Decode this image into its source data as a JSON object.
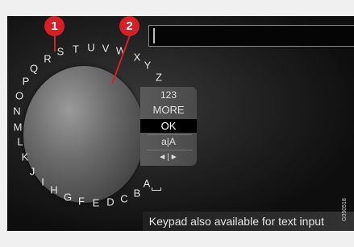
{
  "wheel": {
    "letters": [
      "A",
      "B",
      "C",
      "D",
      "E",
      "F",
      "G",
      "H",
      "I",
      "J",
      "K",
      "L",
      "M",
      "N",
      "O",
      "P",
      "Q",
      "R",
      "S",
      "T",
      "U",
      "V",
      "W",
      "X",
      "Y",
      "Z"
    ]
  },
  "menu": {
    "items": [
      {
        "label": "123"
      },
      {
        "label": "MORE"
      },
      {
        "label": "OK"
      },
      {
        "label": "a|A"
      },
      {
        "label": "◄|►"
      }
    ],
    "selected": "OK"
  },
  "text_input": {
    "value": ""
  },
  "hint": "Keypad also available for text input",
  "callouts": [
    {
      "number": "1"
    },
    {
      "number": "2"
    }
  ],
  "image_code": "G050518",
  "colors": {
    "callout": "#d61f26",
    "screen": "#111111",
    "selected": "#000000"
  }
}
